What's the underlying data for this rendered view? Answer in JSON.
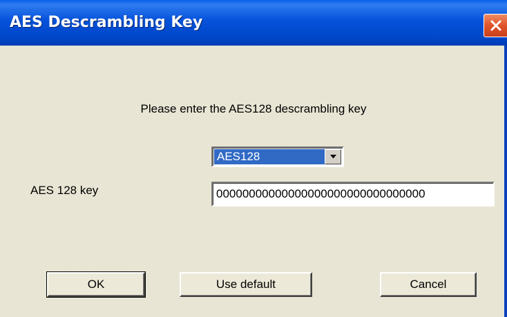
{
  "window": {
    "title": "AES Descrambling Key"
  },
  "dialog": {
    "prompt": "Please enter the AES128 descrambling key",
    "mode_select": {
      "selected": "AES128"
    },
    "key_field": {
      "label": "AES 128 key",
      "value": "00000000000000000000000000000000"
    },
    "buttons": {
      "ok": "OK",
      "use_default": "Use default",
      "cancel": "Cancel"
    }
  },
  "colors": {
    "titlebar": "#0A5FE8",
    "close_button": "#E0542A",
    "dialog_background": "#ECE9D8",
    "selection": "#316AC5"
  },
  "icons": {
    "close": "close-icon",
    "dropdown": "chevron-down-icon"
  }
}
